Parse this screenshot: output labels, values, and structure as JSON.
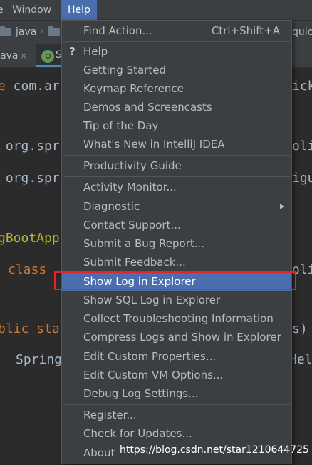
{
  "menubar": {
    "cut_label": "e",
    "window_label": "Window",
    "help_label": "Help"
  },
  "breadcrumb": {
    "segment1": "java",
    "segment_right": "quick"
  },
  "tabs": {
    "left_tab_label": "ava",
    "close_glyph": "×",
    "active_tab_label": "S"
  },
  "code": {
    "line1_kw": "e",
    "line1_text": " com.ar",
    "line1_right": "ick",
    "line2_text": " org.spr",
    "line2_right": "oli",
    "line3_text": " org.spr",
    "line3_right": "igu",
    "line4_text": "gBootApp",
    "line5_kw": "class",
    "line5_right": "oli",
    "line6_kw": "blic sta",
    "line6_right": "s)",
    "line7_text": "Spring",
    "line7_right": "Hel"
  },
  "help_menu": {
    "items": [
      {
        "label": "Find Action...",
        "shortcut": "Ctrl+Shift+A"
      },
      {
        "label": "Help"
      },
      {
        "label": "Getting Started"
      },
      {
        "label": "Keymap Reference"
      },
      {
        "label": "Demos and Screencasts"
      },
      {
        "label": "Tip of the Day"
      },
      {
        "label": "What's New in IntelliJ IDEA"
      },
      {
        "label": "Productivity Guide"
      },
      {
        "label": "Activity Monitor..."
      },
      {
        "label": "Diagnostic"
      },
      {
        "label": "Contact Support..."
      },
      {
        "label": "Submit a Bug Report..."
      },
      {
        "label": "Submit Feedback..."
      },
      {
        "label": "Show Log in Explorer"
      },
      {
        "label": "Show SQL Log in Explorer"
      },
      {
        "label": "Collect Troubleshooting Information"
      },
      {
        "label": "Compress Logs and Show in Explorer"
      },
      {
        "label": "Edit Custom Properties..."
      },
      {
        "label": "Edit Custom VM Options..."
      },
      {
        "label": "Debug Log Settings..."
      },
      {
        "label": "Register..."
      },
      {
        "label": "Check for Updates..."
      },
      {
        "label": "About"
      }
    ],
    "help_icon_glyph": "?",
    "selected_item": "Show Log in Explorer"
  },
  "watermark": "https://blog.csdn.net/star1210644725",
  "colors": {
    "selection": "#4b6eaf",
    "highlight_box": "#e8202a",
    "menu_bg": "#3c3f41",
    "editor_bg": "#2b2b2b"
  }
}
